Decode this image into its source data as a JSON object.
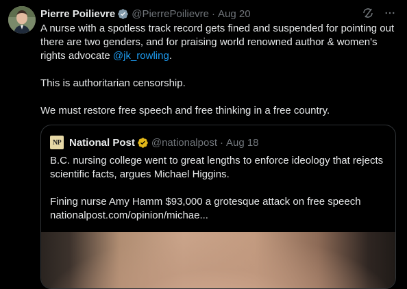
{
  "author": {
    "name": "Pierre Poilievre",
    "handle": "@PierrePoilievre",
    "separator": "·",
    "date": "Aug 20"
  },
  "tweet": {
    "line1_pre": "A nurse with a spotless track record gets fined and suspended for pointing out there are two genders, and for praising world renowned author & women's rights advocate ",
    "mention": "@jk_rowling",
    "line1_post": ".",
    "para2": "This is authoritarian censorship.",
    "para3": "We must restore free speech and free thinking in a free country."
  },
  "quote": {
    "logo_text": "NP",
    "name": "National Post",
    "handle": "@nationalpost",
    "separator": "·",
    "date": "Aug 18",
    "para1": "B.C. nursing college went to great lengths to enforce ideology that rejects scientific facts, argues Michael Higgins.",
    "para2_line1": "Fining nurse Amy Hamm $93,000 a grotesque attack on free speech",
    "para2_line2": "nationalpost.com/opinion/michae..."
  },
  "icons": {
    "verified_badge": "verified-badge-icon",
    "gold_badge": "gold-verified-badge-icon",
    "grok": "grok-icon",
    "more": "more-options-icon"
  },
  "colors": {
    "background": "#000000",
    "text": "#e7e9ea",
    "muted": "#71767b",
    "link": "#1d9bf0",
    "verified": "#829aab",
    "gold": "#e2b719",
    "border": "#2f3336"
  }
}
